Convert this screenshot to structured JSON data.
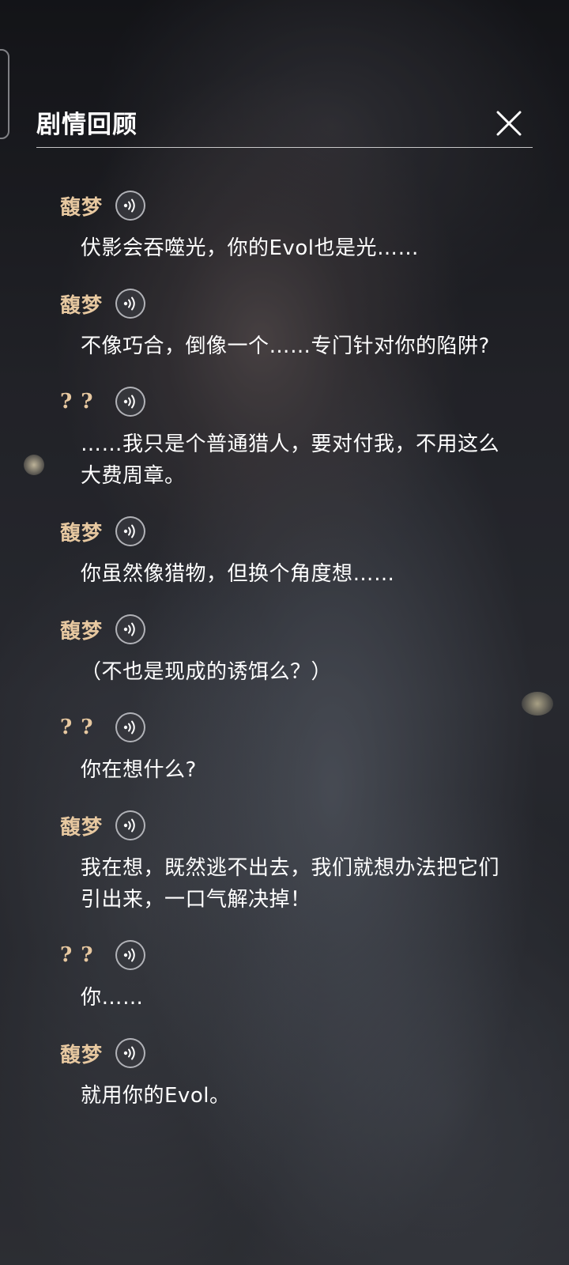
{
  "header": {
    "title": "剧情回顾"
  },
  "entries": [
    {
      "speaker": "馥梦",
      "line": "伏影会吞噬光，你的Evol也是光……"
    },
    {
      "speaker": "馥梦",
      "line": "不像巧合，倒像一个……专门针对你的陷阱?"
    },
    {
      "speaker": "? ?",
      "line": "……我只是个普通猎人，要对付我，不用这么大费周章。"
    },
    {
      "speaker": "馥梦",
      "line": "你虽然像猎物，但换个角度想……"
    },
    {
      "speaker": "馥梦",
      "line": "（不也是现成的诱饵么？）"
    },
    {
      "speaker": "? ?",
      "line": "你在想什么?"
    },
    {
      "speaker": "馥梦",
      "line": "我在想，既然逃不出去，我们就想办法把它们引出来，一口气解决掉！"
    },
    {
      "speaker": "? ?",
      "line": "你……"
    },
    {
      "speaker": "馥梦",
      "line": "就用你的Evol。"
    }
  ],
  "icons": {
    "close": "close-icon",
    "voice": "voice-play-icon"
  },
  "colors": {
    "speaker": "#e7c8a0",
    "text": "#ffffff",
    "divider": "#ffffff"
  }
}
